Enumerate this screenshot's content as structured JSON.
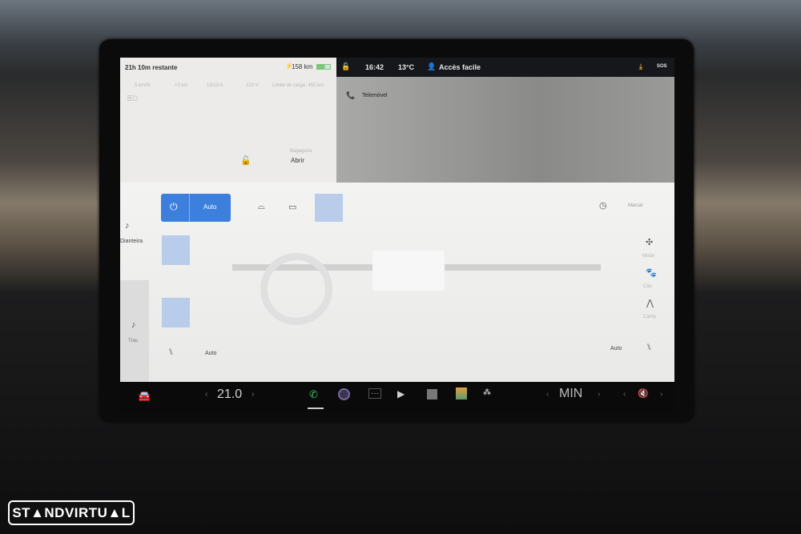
{
  "card": {
    "range_remaining": "21h 10m restante",
    "battery_range": "158 km",
    "stats": [
      "5 km/hr",
      "+0 km",
      "13/13 A",
      "223 V",
      "Limite de carga: 455 km"
    ],
    "trunk_label": "Bagageira",
    "trunk_action": "Abrir"
  },
  "status": {
    "time": "16:42",
    "temperature": "13°C",
    "profile": "Accès facile",
    "sos": "SOS"
  },
  "map": {
    "phone_label": "Telemóvel"
  },
  "climate": {
    "power_mode": "Auto",
    "schedule": "Marcar",
    "front": "Dianteira",
    "rear": "Tras.",
    "left_seat_auto": "Auto",
    "right_seat_auto": "Auto",
    "modes": [
      "Modo",
      "Cão",
      "Camp"
    ]
  },
  "dock": {
    "temperature": "21.0",
    "fan": "MIN"
  },
  "watermark": "STANDVIRTUAL",
  "colors": {
    "accent": "#3c7fdc",
    "status_bar": "#16171a"
  }
}
